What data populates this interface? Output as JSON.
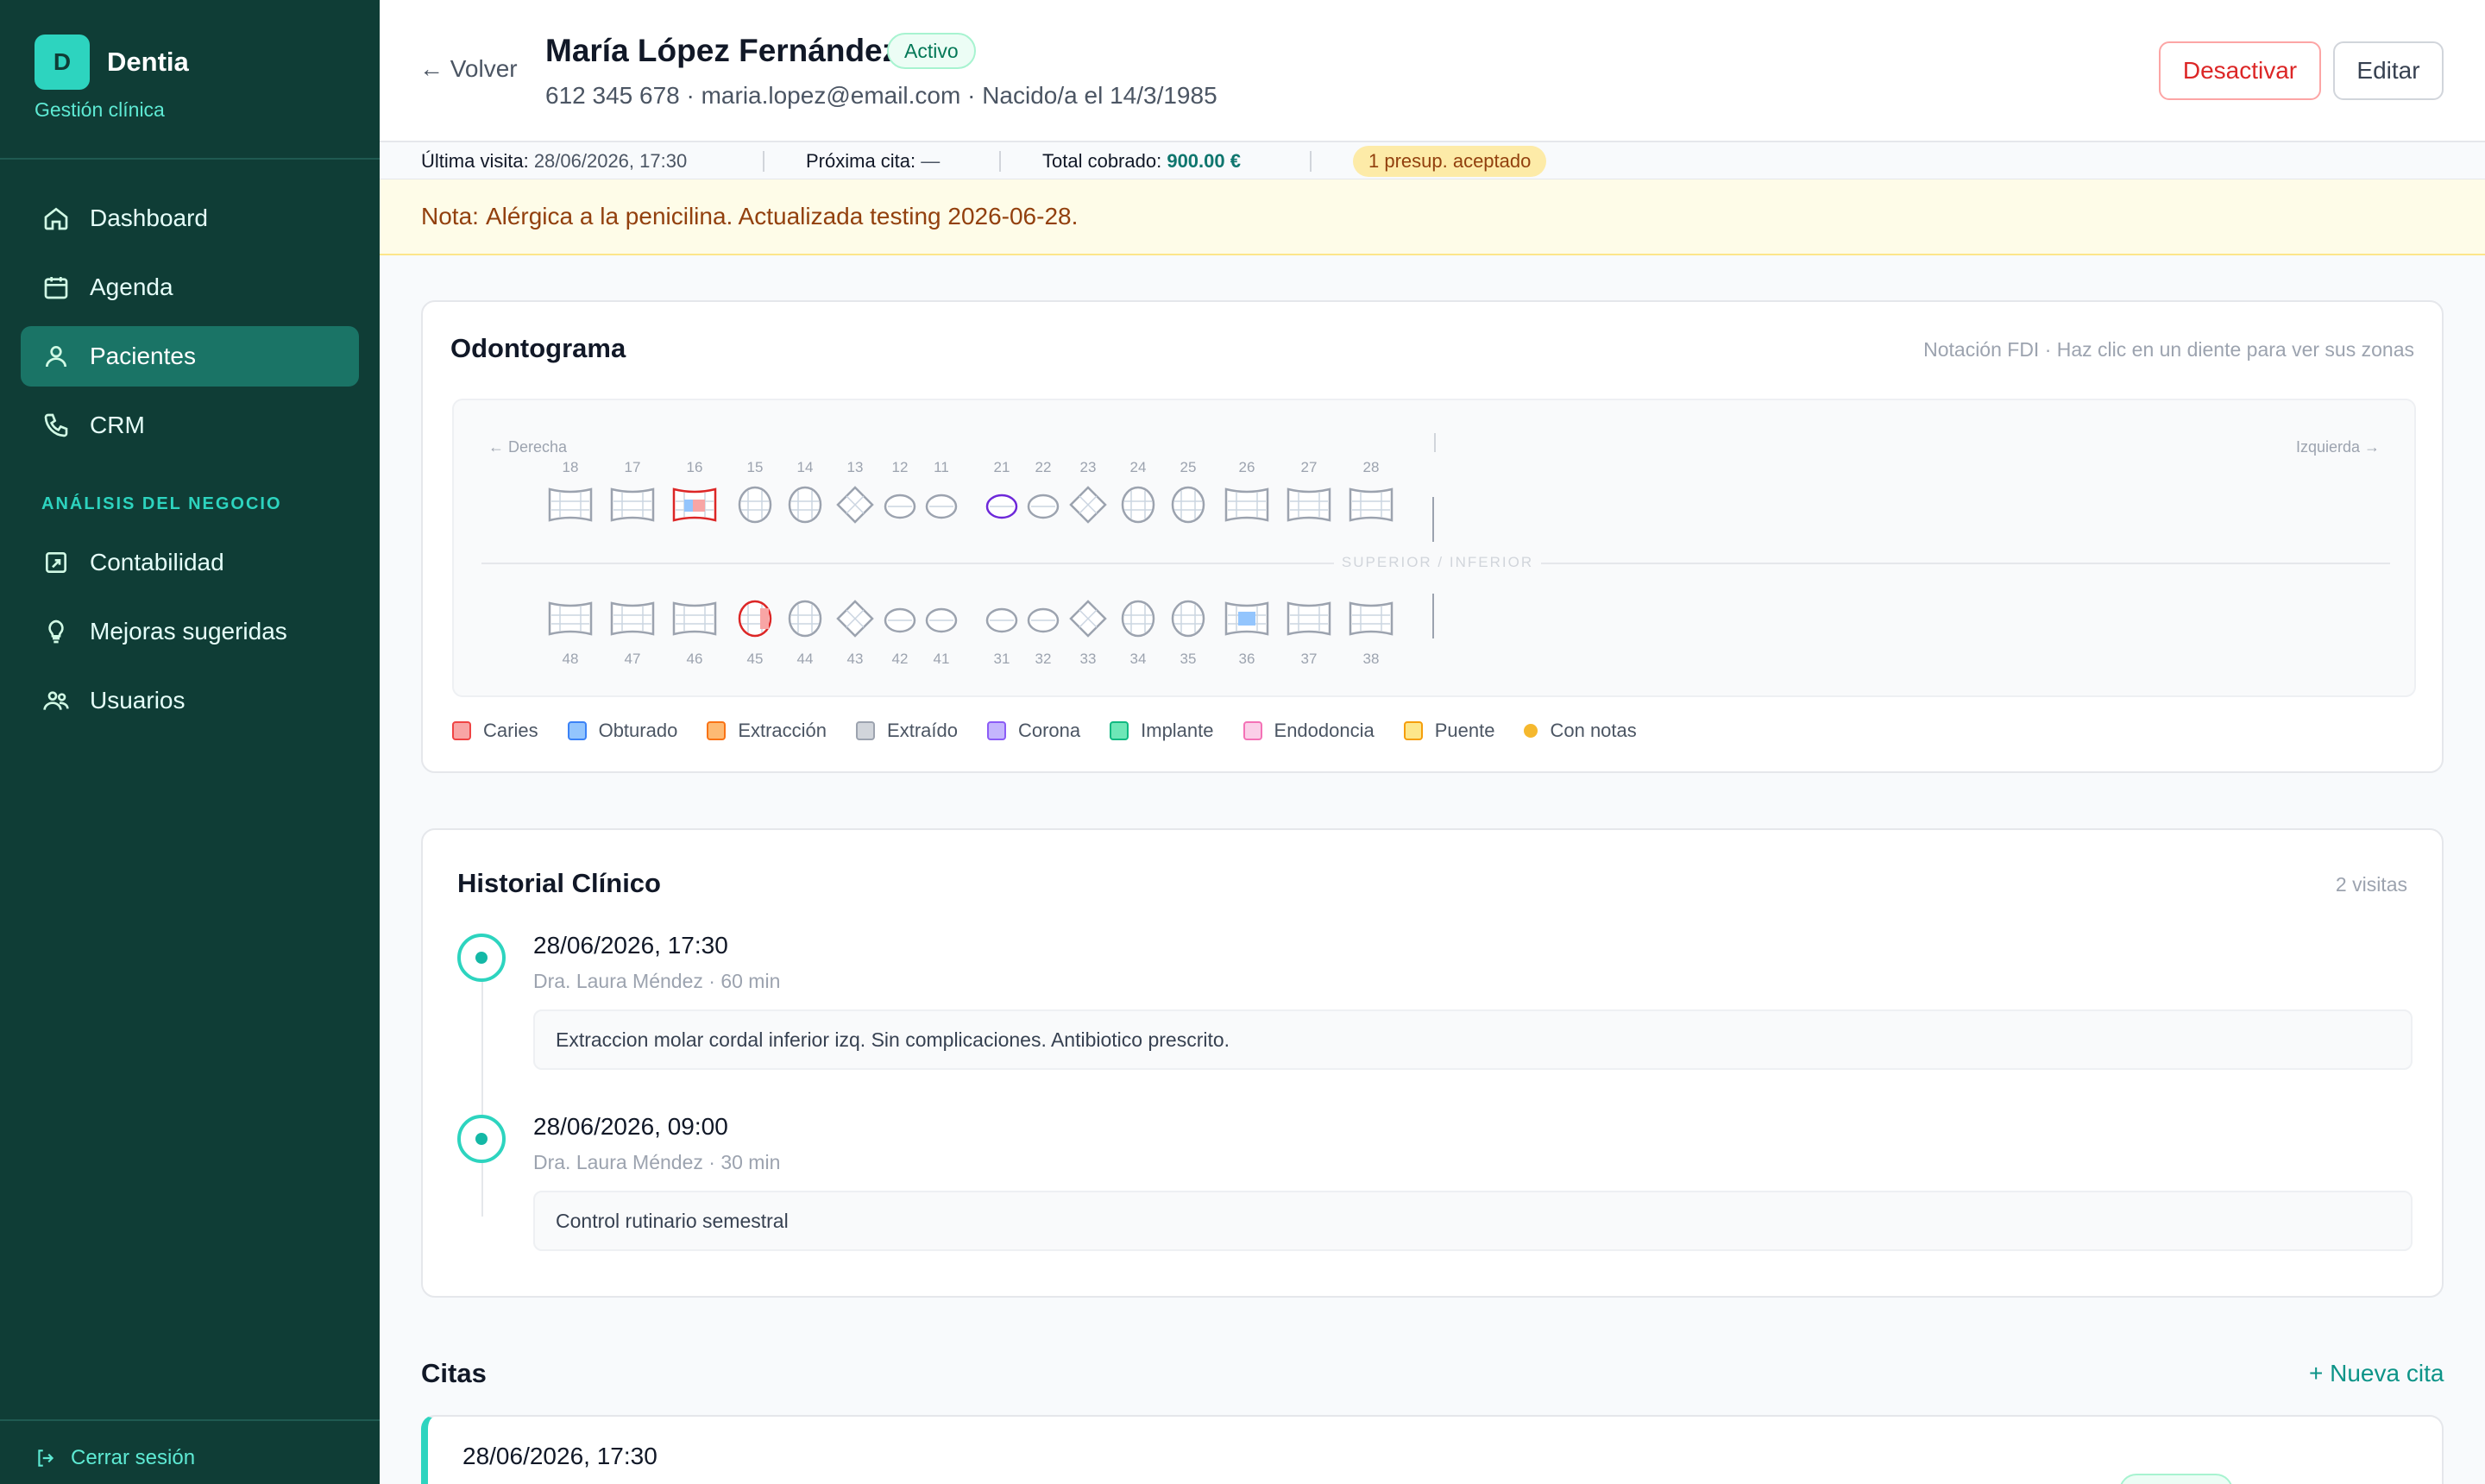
{
  "brand": {
    "logo_letter": "D",
    "name": "Dentia",
    "subtitle": "Gestión clínica"
  },
  "nav": [
    {
      "label": "Dashboard",
      "icon": "home-icon"
    },
    {
      "label": "Agenda",
      "icon": "calendar-icon"
    },
    {
      "label": "Pacientes",
      "icon": "users-icon",
      "active": true
    },
    {
      "label": "CRM",
      "icon": "phone-icon"
    }
  ],
  "nav_section": "ANÁLISIS DEL NEGOCIO",
  "nav_business": [
    {
      "label": "Contabilidad",
      "icon": "ledger-icon"
    },
    {
      "label": "Mejoras sugeridas",
      "icon": "lightbulb-icon"
    },
    {
      "label": "Usuarios",
      "icon": "user-group-icon"
    }
  ],
  "logout": "Cerrar sesión",
  "header": {
    "back": "← Volver",
    "name": "María López Fernández",
    "status": "Activo",
    "meta": "612 345 678 · maria.lopez@email.com · Nacido/a el 14/3/1985",
    "deactivate": "Desactivar",
    "edit": "Editar"
  },
  "stats": {
    "last_visit_label": "Última visita:",
    "last_visit_value": "28/06/2026, 17:30",
    "next_label": "Próxima cita:",
    "next_value": "—",
    "total_label": "Total cobrado:",
    "total_value": "900.00 €",
    "budget_badge": "1 presup. aceptado"
  },
  "note": {
    "label": "Nota:",
    "text": "Alérgica a la penicilina. Actualizada testing 2026-06-28."
  },
  "odontograma": {
    "title": "Odontograma",
    "hint": "Notación FDI · Haz clic en un diente para ver sus zonas",
    "right_label": "← Derecha",
    "left_label": "Izquierda →",
    "mid_label": "SUPERIOR / INFERIOR",
    "upper": [
      "18",
      "17",
      "16",
      "15",
      "14",
      "13",
      "12",
      "11",
      "21",
      "22",
      "23",
      "24",
      "25",
      "26",
      "27",
      "28"
    ],
    "lower": [
      "48",
      "47",
      "46",
      "45",
      "44",
      "43",
      "42",
      "41",
      "31",
      "32",
      "33",
      "34",
      "35",
      "36",
      "37",
      "38"
    ],
    "legend": [
      {
        "label": "Caries",
        "color": "#f8a5a5",
        "border": "#ef4444"
      },
      {
        "label": "Obturado",
        "color": "#93c5fd",
        "border": "#3b82f6"
      },
      {
        "label": "Extracción",
        "color": "#fdba74",
        "border": "#f97316"
      },
      {
        "label": "Extraído",
        "color": "#d1d5db",
        "border": "#9ca3af"
      },
      {
        "label": "Corona",
        "color": "#c4b5fd",
        "border": "#8b5cf6"
      },
      {
        "label": "Implante",
        "color": "#6ee7b7",
        "border": "#10b981"
      },
      {
        "label": "Endodoncia",
        "color": "#fbcfe8",
        "border": "#f472b6"
      },
      {
        "label": "Puente",
        "color": "#fde68a",
        "border": "#f59e0b"
      },
      {
        "label": "Con notas",
        "color": "#f5b82e",
        "border": "none",
        "dot": true
      }
    ]
  },
  "historial": {
    "title": "Historial Clínico",
    "count": "2 visitas",
    "visits": [
      {
        "date": "28/06/2026, 17:30",
        "meta": "Dra. Laura Méndez · 60 min",
        "note": "Extraccion molar cordal inferior izq. Sin complicaciones. Antibiotico prescrito."
      },
      {
        "date": "28/06/2026, 09:00",
        "meta": "Dra. Laura Méndez · 30 min",
        "note": "Control rutinario semestral"
      }
    ]
  },
  "citas": {
    "title": "Citas",
    "new": "+ Nueva cita",
    "first_date": "28/06/2026, 17:30"
  }
}
